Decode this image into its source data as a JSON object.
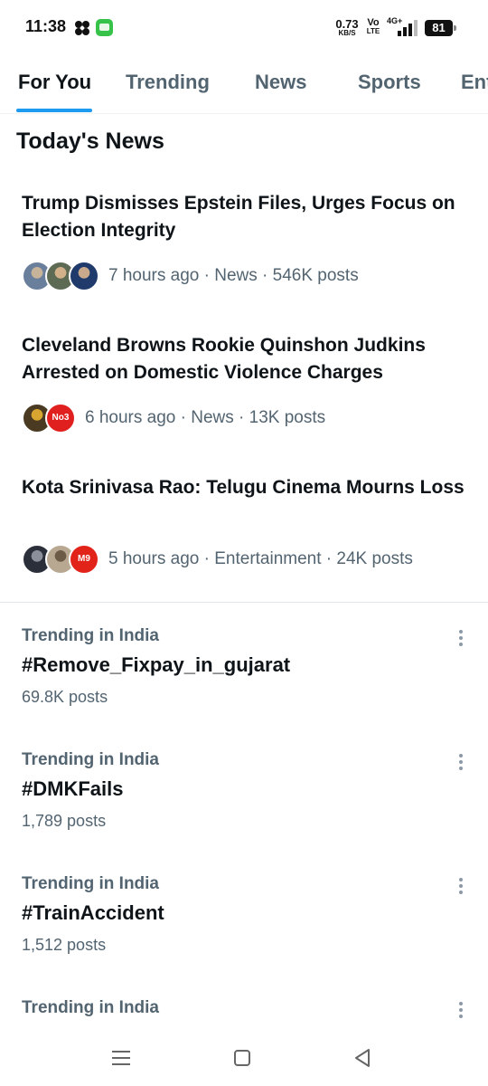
{
  "status_bar": {
    "time": "11:38",
    "net_speed_value": "0.73",
    "net_speed_unit": "KB/S",
    "volte_top": "Vo",
    "volte_bottom": "LTE",
    "network": "4G+",
    "battery": "81",
    "icons": [
      "clover-icon",
      "message-icon",
      "signal-icon",
      "battery-icon"
    ]
  },
  "tabs": [
    {
      "label": "For You",
      "active": true
    },
    {
      "label": "Trending",
      "active": false
    },
    {
      "label": "News",
      "active": false
    },
    {
      "label": "Sports",
      "active": false
    },
    {
      "label": "Entertainment",
      "active": false
    }
  ],
  "section_title": "Today's News",
  "news": [
    {
      "headline": "Trump Dismisses Epstein Files, Urges Focus on Election Integrity",
      "meta": "7 hours ago · News · 546K posts",
      "avatars": [
        {
          "color": "#6a7f9c",
          "accent": "#c7b39a",
          "text": ""
        },
        {
          "color": "#5d6b55",
          "accent": "#d1b08a",
          "text": ""
        },
        {
          "color": "#1f3a6b",
          "accent": "#c9a98b",
          "text": ""
        }
      ]
    },
    {
      "headline": "Cleveland Browns Rookie Quinshon Judkins Arrested on Domestic Violence Charges",
      "meta": "6 hours ago · News · 13K posts",
      "avatars": [
        {
          "color": "#4b3a22",
          "accent": "#d9a531",
          "text": ""
        },
        {
          "color": "#e0201f",
          "accent": "#ffffff",
          "text": "No3"
        }
      ]
    },
    {
      "headline": "Kota Srinivasa Rao: Telugu Cinema Mourns Loss",
      "meta": "5 hours ago · Entertainment · 24K posts",
      "avatars": [
        {
          "color": "#2a2f3a",
          "accent": "#8a8f99",
          "text": ""
        },
        {
          "color": "#b9a891",
          "accent": "#6d5a47",
          "text": ""
        },
        {
          "color": "#e2231a",
          "accent": "#ffffff",
          "text": "M9"
        }
      ]
    }
  ],
  "trends": [
    {
      "context": "Trending in India",
      "name": "#Remove_Fixpay_in_gujarat",
      "count": "69.8K posts"
    },
    {
      "context": "Trending in India",
      "name": "#DMKFails",
      "count": "1,789 posts"
    },
    {
      "context": "Trending in India",
      "name": "#TrainAccident",
      "count": "1,512 posts"
    },
    {
      "context": "Trending in India",
      "name": "",
      "count": ""
    }
  ],
  "navbar": [
    "menu-icon",
    "home-square-icon",
    "back-triangle-icon"
  ],
  "colors": {
    "accent": "#1d9bf0",
    "text_primary": "#0f1419",
    "text_secondary": "#536471"
  }
}
